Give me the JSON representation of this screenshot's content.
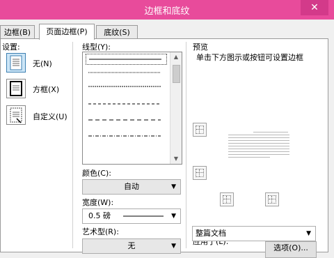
{
  "window": {
    "title": "边框和底纹"
  },
  "tabs": [
    {
      "label": "边框(B)"
    },
    {
      "label": "页面边框(P)"
    },
    {
      "label": "底纹(S)"
    }
  ],
  "settings": {
    "heading": "设置:",
    "options": [
      {
        "label": "无(N)",
        "icon": "none-page-icon",
        "selected": true
      },
      {
        "label": "方框(X)",
        "icon": "box-page-icon",
        "selected": false
      },
      {
        "label": "自定义(U)",
        "icon": "custom-page-icon",
        "selected": false
      }
    ]
  },
  "style": {
    "heading": "线型(Y):",
    "lines": [
      "solid",
      "dotted",
      "dashed-small",
      "dashed",
      "dash-long",
      "dash-dot"
    ]
  },
  "color": {
    "label": "颜色(C):",
    "value": "自动"
  },
  "width": {
    "label": "宽度(W):",
    "value": "0.5 磅"
  },
  "art": {
    "label": "艺术型(R):",
    "value": "无"
  },
  "preview": {
    "heading": "预览",
    "hint": "单击下方图示或按钮可设置边框"
  },
  "apply_to": {
    "label": "应用于(L):",
    "value": "整篇文档"
  },
  "options_button": {
    "label": "选项(O)..."
  },
  "colors": {
    "titlebar": "#e84b9b",
    "selection": "#cde6f7"
  }
}
